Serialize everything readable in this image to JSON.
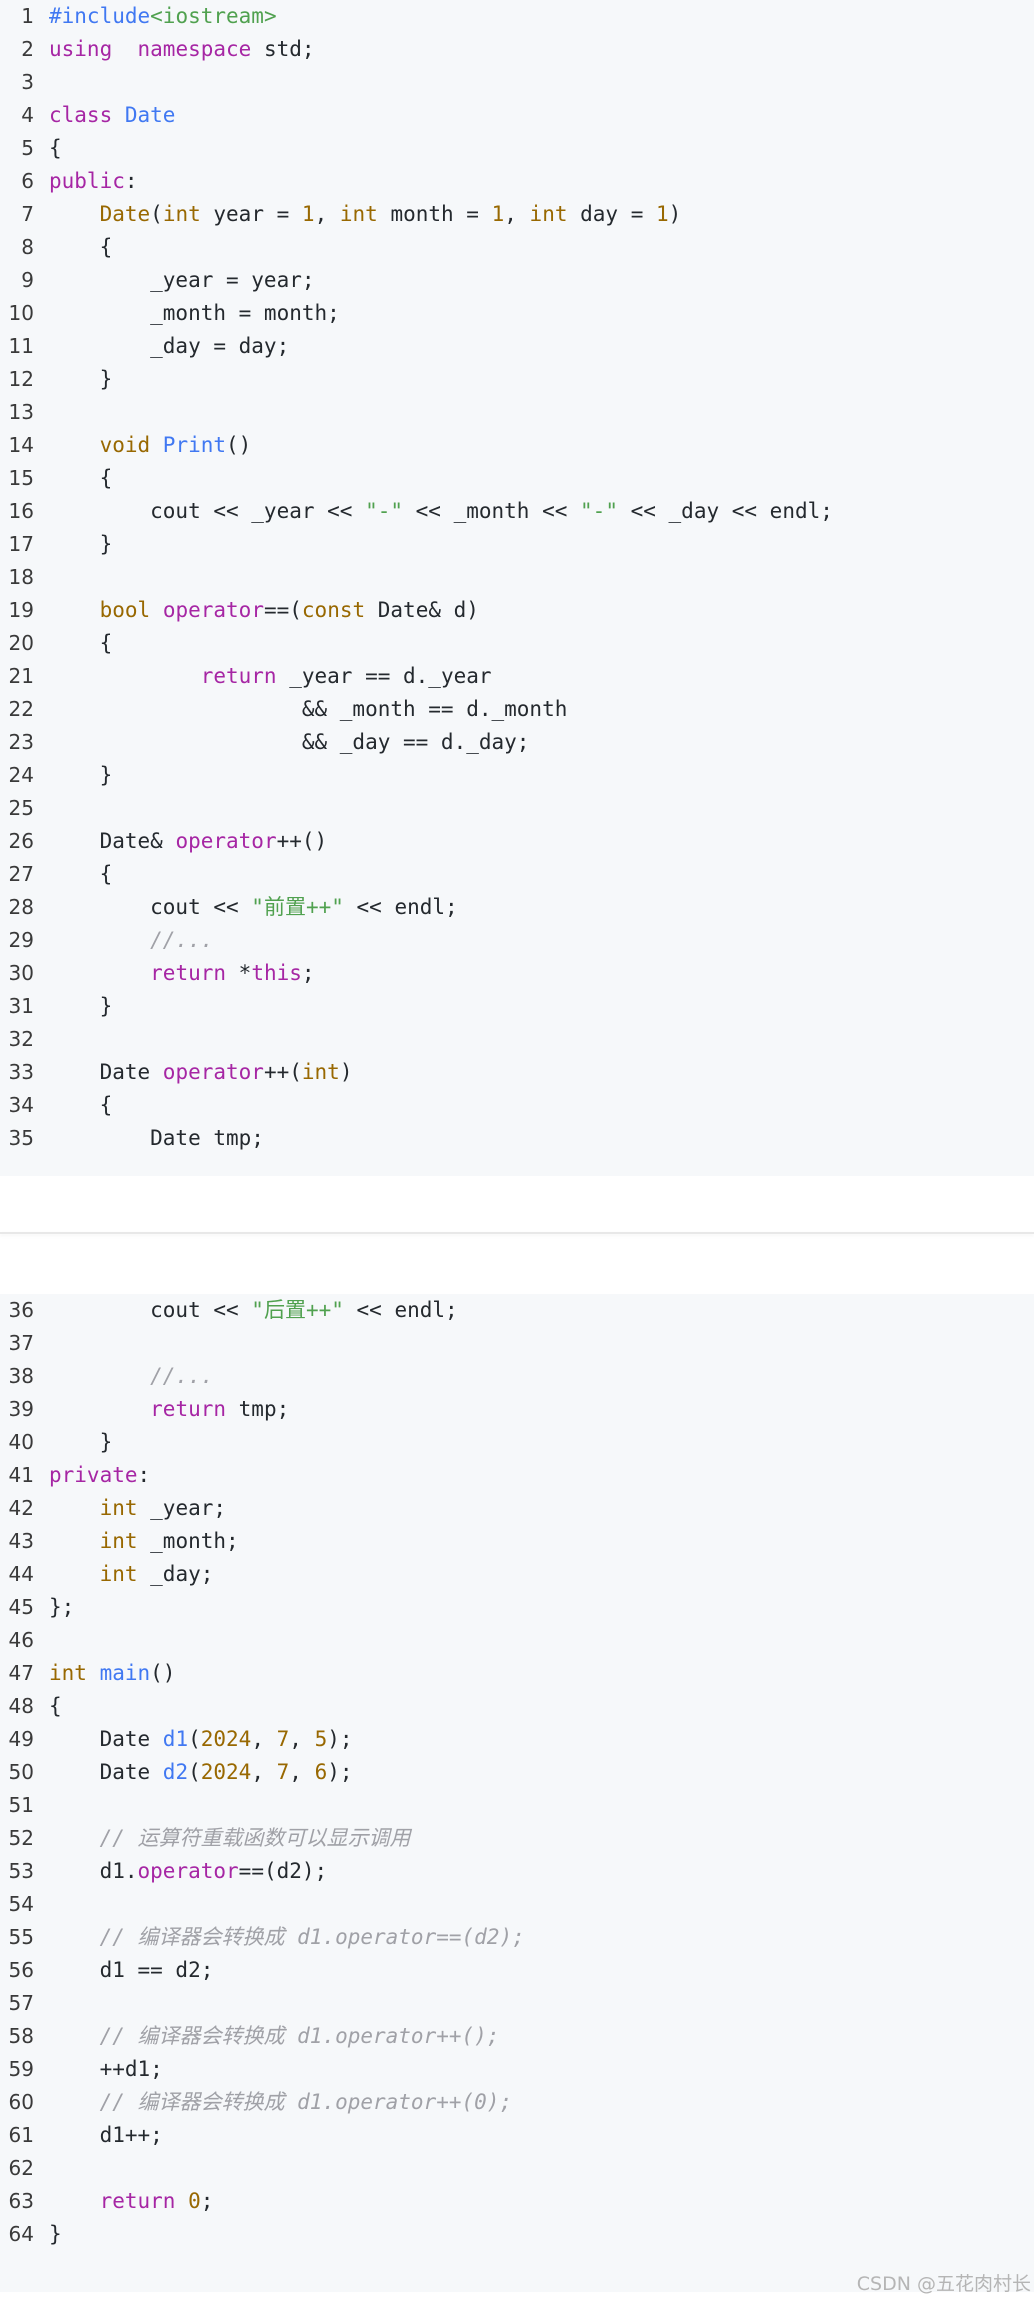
{
  "blocks": [
    {
      "id": "block1",
      "lines": [
        {
          "n": "1",
          "t": [
            [
              "pp",
              "#include"
            ],
            [
              "str",
              "<iostream>"
            ]
          ]
        },
        {
          "n": "2",
          "t": [
            [
              "kw",
              "using"
            ],
            [
              "",
              "  "
            ],
            [
              "kw",
              "namespace"
            ],
            [
              "",
              " std;"
            ]
          ]
        },
        {
          "n": "3",
          "t": []
        },
        {
          "n": "4",
          "t": [
            [
              "kw",
              "class"
            ],
            [
              "",
              ""
            ],
            [
              "fn",
              " Date"
            ]
          ]
        },
        {
          "n": "5",
          "t": [
            [
              "",
              "{"
            ]
          ]
        },
        {
          "n": "6",
          "t": [
            [
              "kw",
              "public"
            ],
            [
              "",
              ":"
            ]
          ]
        },
        {
          "n": "7",
          "t": [
            [
              "",
              "    "
            ],
            [
              "ty",
              "Date"
            ],
            [
              "",
              "("
            ],
            [
              "ty",
              "int"
            ],
            [
              "",
              " year = "
            ],
            [
              "num",
              "1"
            ],
            [
              "",
              ", "
            ],
            [
              "ty",
              "int"
            ],
            [
              "",
              " month = "
            ],
            [
              "num",
              "1"
            ],
            [
              "",
              ", "
            ],
            [
              "ty",
              "int"
            ],
            [
              "",
              " day = "
            ],
            [
              "num",
              "1"
            ],
            [
              "",
              ")"
            ]
          ]
        },
        {
          "n": "8",
          "t": [
            [
              "",
              "    {"
            ]
          ]
        },
        {
          "n": "9",
          "t": [
            [
              "",
              "        _year = year;"
            ]
          ]
        },
        {
          "n": "10",
          "t": [
            [
              "",
              "        _month = month;"
            ]
          ]
        },
        {
          "n": "11",
          "t": [
            [
              "",
              "        _day = day;"
            ]
          ]
        },
        {
          "n": "12",
          "t": [
            [
              "",
              "    }"
            ]
          ]
        },
        {
          "n": "13",
          "t": []
        },
        {
          "n": "14",
          "t": [
            [
              "",
              "    "
            ],
            [
              "ty",
              "void"
            ],
            [
              "",
              ""
            ],
            [
              "fn",
              " Print"
            ],
            [
              "",
              "()"
            ]
          ]
        },
        {
          "n": "15",
          "t": [
            [
              "",
              "    {"
            ]
          ]
        },
        {
          "n": "16",
          "t": [
            [
              "",
              "        cout << _year << "
            ],
            [
              "str",
              "\"-\""
            ],
            [
              "",
              " << _month << "
            ],
            [
              "str",
              "\"-\""
            ],
            [
              "",
              " << _day << endl;"
            ]
          ]
        },
        {
          "n": "17",
          "t": [
            [
              "",
              "    }"
            ]
          ]
        },
        {
          "n": "18",
          "t": []
        },
        {
          "n": "19",
          "t": [
            [
              "",
              "    "
            ],
            [
              "ty",
              "bool"
            ],
            [
              "",
              " "
            ],
            [
              "kw",
              "operator"
            ],
            [
              "",
              "==("
            ],
            [
              "ty",
              "const"
            ],
            [
              "",
              " Date& d)"
            ]
          ]
        },
        {
          "n": "20",
          "t": [
            [
              "",
              "    {"
            ]
          ]
        },
        {
          "n": "21",
          "t": [
            [
              "",
              "            "
            ],
            [
              "kw",
              "return"
            ],
            [
              "",
              " _year == d._year"
            ]
          ]
        },
        {
          "n": "22",
          "t": [
            [
              "",
              "                    && _month == d._month"
            ]
          ]
        },
        {
          "n": "23",
          "t": [
            [
              "",
              "                    && _day == d._day;"
            ]
          ]
        },
        {
          "n": "24",
          "t": [
            [
              "",
              "    }"
            ]
          ]
        },
        {
          "n": "25",
          "t": []
        },
        {
          "n": "26",
          "t": [
            [
              "",
              "    Date& "
            ],
            [
              "kw",
              "operator"
            ],
            [
              "",
              "++()"
            ]
          ]
        },
        {
          "n": "27",
          "t": [
            [
              "",
              "    {"
            ]
          ]
        },
        {
          "n": "28",
          "t": [
            [
              "",
              "        cout << "
            ],
            [
              "str",
              "\"前置++\""
            ],
            [
              "",
              " << endl;"
            ]
          ]
        },
        {
          "n": "29",
          "t": [
            [
              "",
              "        "
            ],
            [
              "cm",
              "//..."
            ]
          ]
        },
        {
          "n": "30",
          "t": [
            [
              "",
              "        "
            ],
            [
              "kw",
              "return"
            ],
            [
              "",
              " *"
            ],
            [
              "kw",
              "this"
            ],
            [
              "",
              ";"
            ]
          ]
        },
        {
          "n": "31",
          "t": [
            [
              "",
              "    }"
            ]
          ]
        },
        {
          "n": "32",
          "t": []
        },
        {
          "n": "33",
          "t": [
            [
              "",
              "    Date "
            ],
            [
              "kw",
              "operator"
            ],
            [
              "",
              "++("
            ],
            [
              "ty",
              "int"
            ],
            [
              "",
              ")"
            ]
          ]
        },
        {
          "n": "34",
          "t": [
            [
              "",
              "    {"
            ]
          ]
        },
        {
          "n": "35",
          "t": [
            [
              "",
              "        Date tmp;"
            ]
          ]
        }
      ]
    },
    {
      "id": "block2",
      "lines": [
        {
          "n": "36",
          "t": [
            [
              "",
              "        cout << "
            ],
            [
              "str",
              "\"后置++\""
            ],
            [
              "",
              " << endl;"
            ]
          ]
        },
        {
          "n": "37",
          "t": []
        },
        {
          "n": "38",
          "t": [
            [
              "",
              "        "
            ],
            [
              "cm",
              "//..."
            ]
          ]
        },
        {
          "n": "39",
          "t": [
            [
              "",
              "        "
            ],
            [
              "kw",
              "return"
            ],
            [
              "",
              " tmp;"
            ]
          ]
        },
        {
          "n": "40",
          "t": [
            [
              "",
              "    }"
            ]
          ]
        },
        {
          "n": "41",
          "t": [
            [
              "kw",
              "private"
            ],
            [
              "",
              ":"
            ]
          ]
        },
        {
          "n": "42",
          "t": [
            [
              "",
              "    "
            ],
            [
              "ty",
              "int"
            ],
            [
              "",
              " _year;"
            ]
          ]
        },
        {
          "n": "43",
          "t": [
            [
              "",
              "    "
            ],
            [
              "ty",
              "int"
            ],
            [
              "",
              " _month;"
            ]
          ]
        },
        {
          "n": "44",
          "t": [
            [
              "",
              "    "
            ],
            [
              "ty",
              "int"
            ],
            [
              "",
              " _day;"
            ]
          ]
        },
        {
          "n": "45",
          "t": [
            [
              "",
              "};"
            ]
          ]
        },
        {
          "n": "46",
          "t": []
        },
        {
          "n": "47",
          "t": [
            [
              "ty",
              "int"
            ],
            [
              "",
              ""
            ],
            [
              "fn",
              " main"
            ],
            [
              "",
              "()"
            ]
          ]
        },
        {
          "n": "48",
          "t": [
            [
              "",
              "{"
            ]
          ]
        },
        {
          "n": "49",
          "t": [
            [
              "",
              "    Date "
            ],
            [
              "fn",
              "d1"
            ],
            [
              "",
              "("
            ],
            [
              "num",
              "2024"
            ],
            [
              "",
              ", "
            ],
            [
              "num",
              "7"
            ],
            [
              "",
              ", "
            ],
            [
              "num",
              "5"
            ],
            [
              "",
              ");"
            ]
          ]
        },
        {
          "n": "50",
          "t": [
            [
              "",
              "    Date "
            ],
            [
              "fn",
              "d2"
            ],
            [
              "",
              "("
            ],
            [
              "num",
              "2024"
            ],
            [
              "",
              ", "
            ],
            [
              "num",
              "7"
            ],
            [
              "",
              ", "
            ],
            [
              "num",
              "6"
            ],
            [
              "",
              ");"
            ]
          ]
        },
        {
          "n": "51",
          "t": []
        },
        {
          "n": "52",
          "t": [
            [
              "",
              "    "
            ],
            [
              "cm",
              "// 运算符重载函数可以显示调用"
            ]
          ]
        },
        {
          "n": "53",
          "t": [
            [
              "",
              "    d1."
            ],
            [
              "kw",
              "operator"
            ],
            [
              "",
              "==(d2);"
            ]
          ]
        },
        {
          "n": "54",
          "t": []
        },
        {
          "n": "55",
          "t": [
            [
              "",
              "    "
            ],
            [
              "cm",
              "// 编译器会转换成 d1.operator==(d2);"
            ]
          ]
        },
        {
          "n": "56",
          "t": [
            [
              "",
              "    d1 == d2;"
            ]
          ]
        },
        {
          "n": "57",
          "t": []
        },
        {
          "n": "58",
          "t": [
            [
              "",
              "    "
            ],
            [
              "cm",
              "// 编译器会转换成 d1.operator++();"
            ]
          ]
        },
        {
          "n": "59",
          "t": [
            [
              "",
              "    ++d1;"
            ]
          ]
        },
        {
          "n": "60",
          "t": [
            [
              "",
              "    "
            ],
            [
              "cm",
              "// 编译器会转换成 d1.operator++(0);"
            ]
          ]
        },
        {
          "n": "61",
          "t": [
            [
              "",
              "    d1++;"
            ]
          ]
        },
        {
          "n": "62",
          "t": []
        },
        {
          "n": "63",
          "t": [
            [
              "",
              "    "
            ],
            [
              "kw",
              "return"
            ],
            [
              "",
              " "
            ],
            [
              "num",
              "0"
            ],
            [
              "",
              ";"
            ]
          ]
        },
        {
          "n": "64",
          "t": [
            [
              "",
              "}"
            ]
          ]
        }
      ]
    }
  ],
  "watermark": "CSDN @五花肉村长"
}
